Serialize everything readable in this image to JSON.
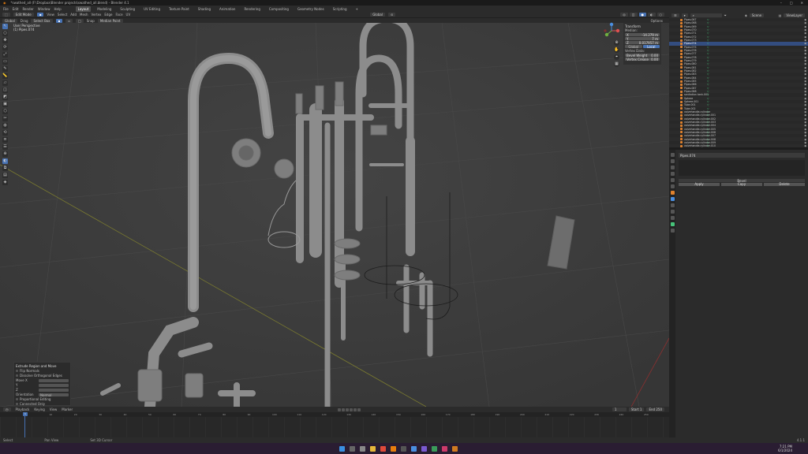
{
  "window": {
    "title": "*swathed_all (F:\\Dropbox\\Blender projects\\swathed_all.blend) - Blender 4.1",
    "controls": [
      "–",
      "□",
      "✕"
    ]
  },
  "menu": [
    "File",
    "Edit",
    "Render",
    "Window",
    "Help"
  ],
  "workspaces": [
    "Layout",
    "Modeling",
    "Sculpting",
    "UV Editing",
    "Texture Paint",
    "Shading",
    "Animation",
    "Rendering",
    "Compositing",
    "Geometry Nodes",
    "Scripting",
    "+"
  ],
  "active_workspace": "Layout",
  "header": {
    "mode": "Edit Mode",
    "menus": [
      "View",
      "Select",
      "Add",
      "Mesh",
      "Vertex",
      "Edge",
      "Face",
      "UV"
    ],
    "orientation": "Global",
    "pivot": "⊙"
  },
  "toolbar2": {
    "orient": "Global",
    "drag_label": "Drag",
    "drag_value": "Select Box",
    "options": "Options",
    "snap": "Snap",
    "transform_pivot": "Median Point"
  },
  "viewport": {
    "overlay_line1": "User Perspective",
    "overlay_line2": "(1) Pipes.074"
  },
  "tools": [
    "↖",
    "○",
    "✥",
    "⟳",
    "⤢",
    "▭",
    "✎",
    "📏",
    "▱",
    "◫",
    "◩",
    "▣",
    "⬡",
    "✂",
    "◍",
    "⟲",
    "≡",
    "☰",
    "⊕",
    "◐",
    "⧉",
    "▤",
    "◈"
  ],
  "npanel": {
    "title": "Transform",
    "median": "Median:",
    "x_label": "X",
    "x_value": "-14.279 m",
    "y_label": "Y",
    "y_value": "7 m",
    "z_label": "Z",
    "z_value": "0.017957 m",
    "global": "Global",
    "local": "Local",
    "vertex_data": "Vertex Data:",
    "bevel": "Bevel Weight",
    "bevel_value": "0.00",
    "crease": "Vertex Crease",
    "crease_value": "0.00"
  },
  "lastop": {
    "title": "Extrude Region and Move",
    "flip": "Flip Normals",
    "dissolve": "Dissolve Orthogonal Edges",
    "move": "Move X",
    "y": "Y",
    "z": "Z",
    "orient_label": "Orientation",
    "orient_value": "Normal",
    "proportional": "Proportional Editing",
    "prop_connected": "Connected Only"
  },
  "timeline": {
    "menus": [
      "Playback",
      "Keying",
      "View",
      "Marker"
    ],
    "start_label": "Start",
    "start": "1",
    "end_label": "End",
    "end": "250",
    "current": "1",
    "ticks": [
      "0",
      "10",
      "20",
      "30",
      "40",
      "50",
      "60",
      "70",
      "80",
      "90",
      "100",
      "110",
      "120",
      "130",
      "140",
      "150",
      "160",
      "170",
      "180",
      "190",
      "200",
      "210",
      "220",
      "230",
      "240",
      "250"
    ]
  },
  "statusbar": {
    "a": "Select",
    "b": "Pan View",
    "c": "Set 3D Cursor",
    "version": "4.1.1"
  },
  "outliner": {
    "search": "Scene",
    "layer": "ViewLayer",
    "items": [
      "Pipes.067",
      "Pipes.068",
      "Pipes.069",
      "Pipes.070",
      "Pipes.071",
      "Pipes.072",
      "Pipes.073",
      "Pipes.074",
      "Pipes.075",
      "Pipes.076",
      "Pipes.077",
      "Pipes.078",
      "Pipes.079",
      "Pipes.080",
      "Pipes.081",
      "Pipes.082",
      "Pipes.083",
      "Pipes.084",
      "Pipes.085",
      "Pipes.086",
      "Pipes.087",
      "Pipes.088",
      "sanitation tank.001",
      "Sphere",
      "Sphere.001",
      "Tube.001",
      "Tube.002",
      "valvehandle.cylinder",
      "valvehandle.cylinder.001",
      "valvehandle.cylinder.002",
      "valvehandle.cylinder.003",
      "valvehandle.cylinder.004",
      "valvehandle.cylinder.005",
      "valvehandle.cylinder.006",
      "valvehandle.cylinder.007",
      "valvehandle.cylinder.008",
      "valvehandle.cylinder.009",
      "valvehandle.cylinder.010",
      "valvehandle.cylinder.011"
    ],
    "selected": 7
  },
  "properties": {
    "object": "Pipes.074",
    "modifier": "Bevel",
    "apply": "Apply",
    "copy": "Copy",
    "delete": "Delete"
  },
  "taskbar": {
    "time": "7:21 PM",
    "date": "6/1/2024"
  },
  "colors": {
    "accent": "#4772b3",
    "viewport": "#3d3d3d",
    "object_orange": "#e1822d"
  }
}
